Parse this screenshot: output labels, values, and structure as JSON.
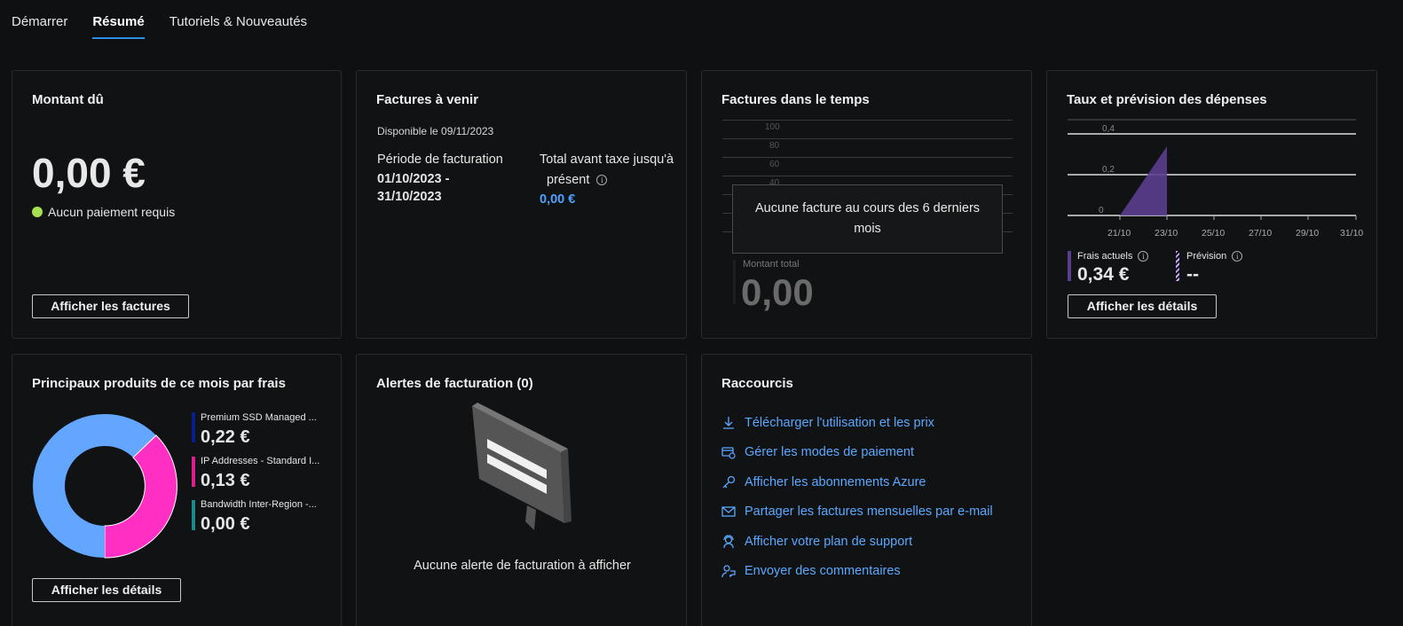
{
  "tabs": [
    "Démarrer",
    "Résumé",
    "Tutoriels & Nouveautés"
  ],
  "amount_due": {
    "title": "Montant dû",
    "value": "0,00 €",
    "status": "Aucun paiement requis",
    "status_color": "#a4e052",
    "button": "Afficher les factures"
  },
  "upcoming": {
    "title": "Factures à venir",
    "available": "Disponible le 09/11/2023",
    "period_label": "Période de facturation",
    "period_value_line1": "01/10/2023 -",
    "period_value_line2": "31/10/2023",
    "total_label_line1": "Total avant taxe jusqu'à",
    "total_label_line2": "présent",
    "total_value": "0,00 €"
  },
  "invoices_over_time": {
    "title": "Factures dans le temps",
    "y_ticks": [
      "100",
      "80",
      "60",
      "40",
      "20",
      "0"
    ],
    "empty_message": "Aucune facture au cours des 6 derniers mois",
    "total_label": "Montant total",
    "total_value": "0,00"
  },
  "spending": {
    "title": "Taux et prévision des dépenses",
    "current_label": "Frais actuels",
    "current_value": "0,34 €",
    "forecast_label": "Prévision",
    "forecast_value": "--",
    "button": "Afficher les détails",
    "current_color": "#5b3e8e"
  },
  "chart_data": {
    "type": "area",
    "x": [
      "21/10",
      "23/10",
      "25/10",
      "27/10",
      "29/10",
      "31/10"
    ],
    "y_ticks": [
      "0,4",
      "0,2",
      "0"
    ],
    "ylim": [
      0,
      0.4
    ],
    "series": [
      {
        "name": "Frais actuels",
        "points": [
          [
            "21/10",
            0
          ],
          [
            "23/10",
            0.34
          ]
        ]
      }
    ]
  },
  "top_products": {
    "title": "Principaux produits de ce mois par frais",
    "items": [
      {
        "name": "Premium SSD Managed ...",
        "value": "0,22 €",
        "color": "#0a1f8f"
      },
      {
        "name": "IP Addresses - Standard I...",
        "value": "0,13 €",
        "color": "#e01f8f"
      },
      {
        "name": "Bandwidth Inter-Region -...",
        "value": "0,00 €",
        "color": "#1d8a8a"
      }
    ],
    "donut": [
      {
        "value": 0.22,
        "color": "#63a6ff"
      },
      {
        "value": 0.13,
        "color": "#ff2fc3"
      }
    ],
    "button": "Afficher les détails"
  },
  "alerts": {
    "title": "Alertes de facturation (0)",
    "empty_message": "Aucune alerte de facturation à afficher"
  },
  "shortcuts": {
    "title": "Raccourcis",
    "items": [
      "Télécharger l'utilisation et les prix",
      "Gérer les modes de paiement",
      "Afficher les abonnements Azure",
      "Partager les factures mensuelles par e-mail",
      "Afficher votre plan de support",
      "Envoyer des commentaires"
    ]
  }
}
